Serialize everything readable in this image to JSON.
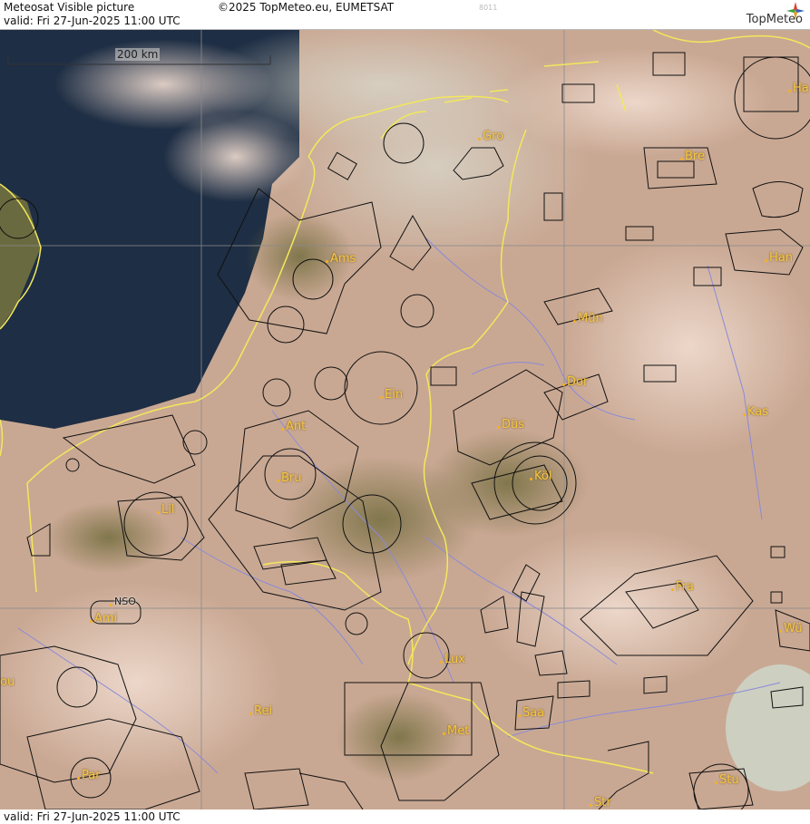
{
  "header": {
    "product": "Meteosat Visible picture",
    "copyright": "©2025 TopMeteo.eu, EUMETSAT",
    "code": "8011",
    "valid": "valid:  Fri  27-Jun-2025  11:00 UTC",
    "logo_text": "TopMeteo"
  },
  "footer": {
    "valid": "valid:  Fri  27-Jun-2025  11:00 UTC"
  },
  "scale_bar": {
    "label": "200 km"
  },
  "cities": {
    "gro": "Gro",
    "bre": "Bre",
    "ha": "Ha",
    "ams": "Ams",
    "han": "Han",
    "mun": "Mün",
    "ein": "Ein",
    "dor": "Dor",
    "kas": "Kas",
    "ant": "Ant",
    "dus": "Düs",
    "bru": "Bru",
    "kol": "Köl",
    "lil": "Lil",
    "fra": "Fra",
    "nso": "NSO",
    "ami": "Ami",
    "wu": "Wü",
    "lux": "Lux",
    "ou": "ou",
    "rei": "Rei",
    "saa": "Saa",
    "met": "Met",
    "par": "Par",
    "stu": "Stu",
    "str": "Str"
  },
  "colors": {
    "land": "#c9a893",
    "sea": "#1e2e44",
    "border": "#f2e85a",
    "grid": "#8a8a8a",
    "river": "#8a8ad8",
    "airspace": "#111111",
    "city": "#f7c840"
  }
}
